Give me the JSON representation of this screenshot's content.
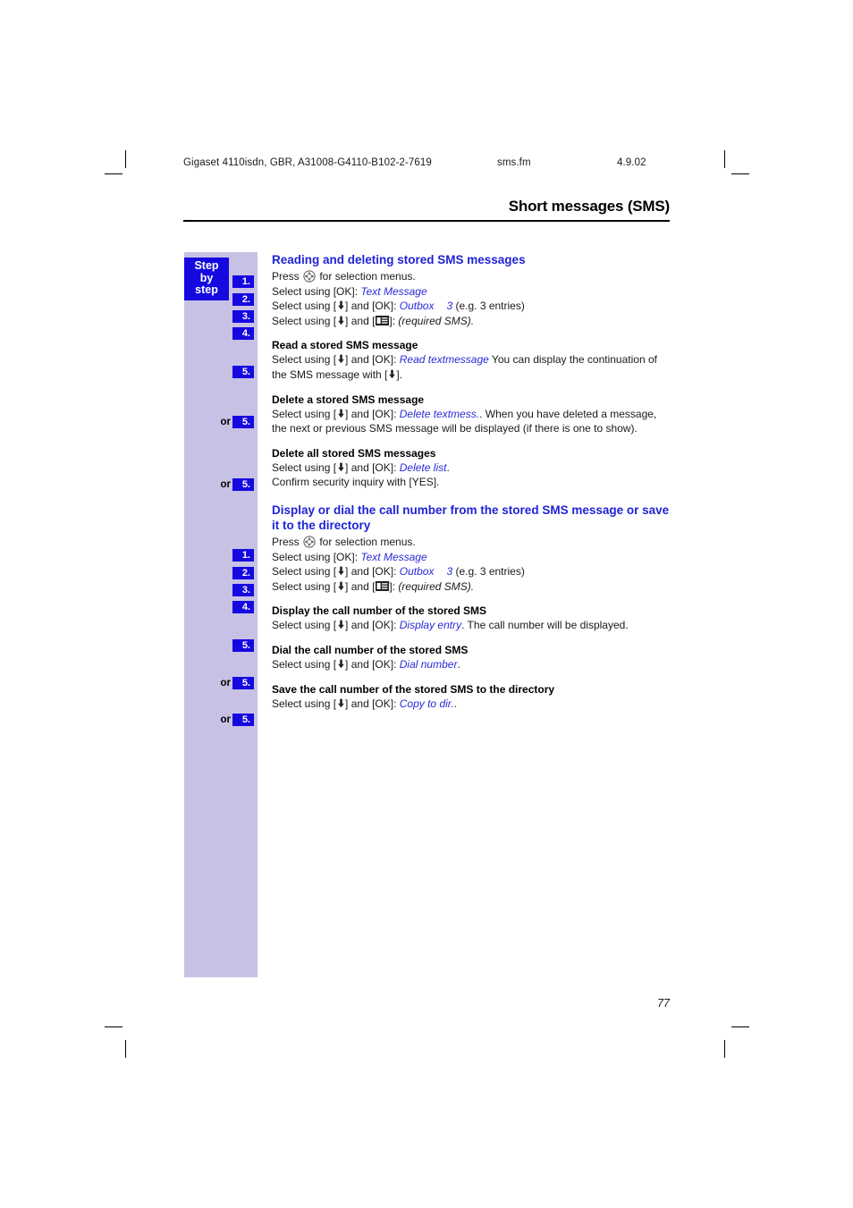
{
  "runhead": {
    "document": "Gigaset 4110isdn, GBR, A31008-G4110-B102-2-7619",
    "file": "sms.fm",
    "date": "4.9.02"
  },
  "chapter_title": "Short messages (SMS)",
  "sidebar": {
    "label_line1": "Step",
    "label_line2": "by",
    "label_line3": "step",
    "or_label": "or",
    "steps": [
      {
        "num": "1."
      },
      {
        "num": "2."
      },
      {
        "num": "3."
      },
      {
        "num": "4."
      },
      {
        "num": "5."
      },
      {
        "num": "5."
      },
      {
        "num": "5."
      },
      {
        "num": "1."
      },
      {
        "num": "2."
      },
      {
        "num": "3."
      },
      {
        "num": "4."
      },
      {
        "num": "5."
      },
      {
        "num": "5."
      },
      {
        "num": "5."
      }
    ]
  },
  "section1": {
    "heading": "Reading and deleting stored SMS messages",
    "step1_pre": "Press ",
    "step1_post": " for selection menus.",
    "step2_pre": "Select using [OK]: ",
    "step2_value": "Text Message",
    "step3_pre": "Select using [",
    "step3_mid": "] and [OK]: ",
    "step3_value": "Outbox",
    "step3_count": "3",
    "step3_post": "(e.g. 3 entries)",
    "step4_pre": "Select using [",
    "step4_mid": "] and [",
    "step4_post": "]: ",
    "step4_value": "(required SMS)."
  },
  "section1_sub1": {
    "heading": "Read a stored SMS message",
    "pre": "Select using [",
    "mid": "] and [OK]: ",
    "value": "Read textmessage",
    "post": " You can display the continuation of the SMS message with [",
    "tail": "]."
  },
  "section1_sub2": {
    "heading": "Delete a stored SMS message",
    "pre": "Select using [",
    "mid": "] and [OK]: ",
    "value": "Delete textmess.",
    "post": ". When you have deleted a message, the next or previous SMS message will be displayed (if there is one to show)."
  },
  "section1_sub3": {
    "heading": "Delete all stored SMS messages",
    "pre": "Select using [",
    "mid": "] and [OK]: ",
    "value": "Delete list",
    "post": ".",
    "line2": "Confirm security inquiry with [YES]."
  },
  "section2": {
    "heading": "Display or dial the call number from the stored SMS message or save it to the directory",
    "step1_pre": "Press ",
    "step1_post": " for selection menus.",
    "step2_pre": "Select using [OK]: ",
    "step2_value": "Text Message",
    "step3_pre": "Select using [",
    "step3_mid": "] and [OK]: ",
    "step3_value": "Outbox",
    "step3_count": "3",
    "step3_post": "(e.g. 3 entries)",
    "step4_pre": "Select using [",
    "step4_mid": "] and [",
    "step4_post": "]: ",
    "step4_value": "(required SMS)."
  },
  "section2_sub1": {
    "heading": "Display the call number of the stored SMS",
    "pre": "Select using [",
    "mid": "] and [OK]: ",
    "value": "Display entry",
    "post": ". The call number will be displayed."
  },
  "section2_sub2": {
    "heading": "Dial the call number of the stored SMS",
    "pre": "Select using [",
    "mid": "] and [OK]: ",
    "value": "Dial number",
    "post": "."
  },
  "section2_sub3": {
    "heading": "Save the call number of the stored SMS to the directory",
    "pre": "Select using [",
    "mid": "] and [OK]: ",
    "value": "Copy to dir.",
    "post": "."
  },
  "page_number": "77",
  "colors": {
    "band": "#c8c1e6",
    "chip": "#1509e0",
    "heading_blue": "#1f23d6",
    "value_blue": "#2a2ad8"
  }
}
